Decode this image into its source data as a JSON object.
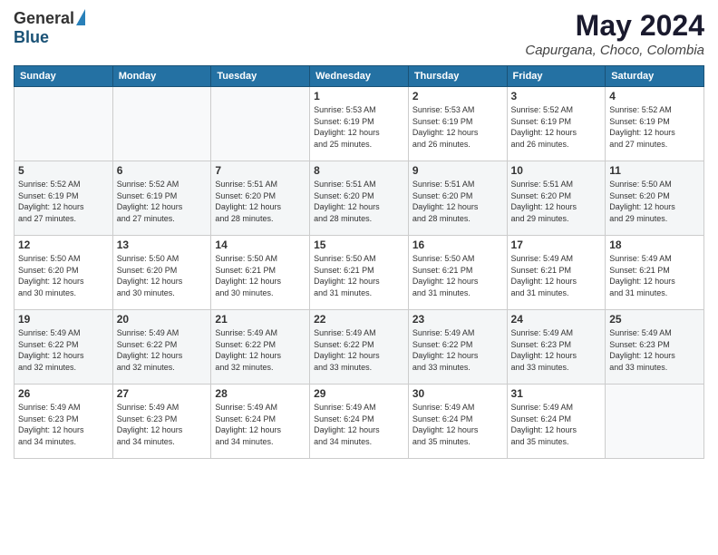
{
  "logo": {
    "general": "General",
    "blue": "Blue"
  },
  "title": {
    "month": "May 2024",
    "location": "Capurgana, Choco, Colombia"
  },
  "days_header": [
    "Sunday",
    "Monday",
    "Tuesday",
    "Wednesday",
    "Thursday",
    "Friday",
    "Saturday"
  ],
  "weeks": [
    [
      {
        "day": "",
        "info": ""
      },
      {
        "day": "",
        "info": ""
      },
      {
        "day": "",
        "info": ""
      },
      {
        "day": "1",
        "info": "Sunrise: 5:53 AM\nSunset: 6:19 PM\nDaylight: 12 hours\nand 25 minutes."
      },
      {
        "day": "2",
        "info": "Sunrise: 5:53 AM\nSunset: 6:19 PM\nDaylight: 12 hours\nand 26 minutes."
      },
      {
        "day": "3",
        "info": "Sunrise: 5:52 AM\nSunset: 6:19 PM\nDaylight: 12 hours\nand 26 minutes."
      },
      {
        "day": "4",
        "info": "Sunrise: 5:52 AM\nSunset: 6:19 PM\nDaylight: 12 hours\nand 27 minutes."
      }
    ],
    [
      {
        "day": "5",
        "info": "Sunrise: 5:52 AM\nSunset: 6:19 PM\nDaylight: 12 hours\nand 27 minutes."
      },
      {
        "day": "6",
        "info": "Sunrise: 5:52 AM\nSunset: 6:19 PM\nDaylight: 12 hours\nand 27 minutes."
      },
      {
        "day": "7",
        "info": "Sunrise: 5:51 AM\nSunset: 6:20 PM\nDaylight: 12 hours\nand 28 minutes."
      },
      {
        "day": "8",
        "info": "Sunrise: 5:51 AM\nSunset: 6:20 PM\nDaylight: 12 hours\nand 28 minutes."
      },
      {
        "day": "9",
        "info": "Sunrise: 5:51 AM\nSunset: 6:20 PM\nDaylight: 12 hours\nand 28 minutes."
      },
      {
        "day": "10",
        "info": "Sunrise: 5:51 AM\nSunset: 6:20 PM\nDaylight: 12 hours\nand 29 minutes."
      },
      {
        "day": "11",
        "info": "Sunrise: 5:50 AM\nSunset: 6:20 PM\nDaylight: 12 hours\nand 29 minutes."
      }
    ],
    [
      {
        "day": "12",
        "info": "Sunrise: 5:50 AM\nSunset: 6:20 PM\nDaylight: 12 hours\nand 30 minutes."
      },
      {
        "day": "13",
        "info": "Sunrise: 5:50 AM\nSunset: 6:20 PM\nDaylight: 12 hours\nand 30 minutes."
      },
      {
        "day": "14",
        "info": "Sunrise: 5:50 AM\nSunset: 6:21 PM\nDaylight: 12 hours\nand 30 minutes."
      },
      {
        "day": "15",
        "info": "Sunrise: 5:50 AM\nSunset: 6:21 PM\nDaylight: 12 hours\nand 31 minutes."
      },
      {
        "day": "16",
        "info": "Sunrise: 5:50 AM\nSunset: 6:21 PM\nDaylight: 12 hours\nand 31 minutes."
      },
      {
        "day": "17",
        "info": "Sunrise: 5:49 AM\nSunset: 6:21 PM\nDaylight: 12 hours\nand 31 minutes."
      },
      {
        "day": "18",
        "info": "Sunrise: 5:49 AM\nSunset: 6:21 PM\nDaylight: 12 hours\nand 31 minutes."
      }
    ],
    [
      {
        "day": "19",
        "info": "Sunrise: 5:49 AM\nSunset: 6:22 PM\nDaylight: 12 hours\nand 32 minutes."
      },
      {
        "day": "20",
        "info": "Sunrise: 5:49 AM\nSunset: 6:22 PM\nDaylight: 12 hours\nand 32 minutes."
      },
      {
        "day": "21",
        "info": "Sunrise: 5:49 AM\nSunset: 6:22 PM\nDaylight: 12 hours\nand 32 minutes."
      },
      {
        "day": "22",
        "info": "Sunrise: 5:49 AM\nSunset: 6:22 PM\nDaylight: 12 hours\nand 33 minutes."
      },
      {
        "day": "23",
        "info": "Sunrise: 5:49 AM\nSunset: 6:22 PM\nDaylight: 12 hours\nand 33 minutes."
      },
      {
        "day": "24",
        "info": "Sunrise: 5:49 AM\nSunset: 6:23 PM\nDaylight: 12 hours\nand 33 minutes."
      },
      {
        "day": "25",
        "info": "Sunrise: 5:49 AM\nSunset: 6:23 PM\nDaylight: 12 hours\nand 33 minutes."
      }
    ],
    [
      {
        "day": "26",
        "info": "Sunrise: 5:49 AM\nSunset: 6:23 PM\nDaylight: 12 hours\nand 34 minutes."
      },
      {
        "day": "27",
        "info": "Sunrise: 5:49 AM\nSunset: 6:23 PM\nDaylight: 12 hours\nand 34 minutes."
      },
      {
        "day": "28",
        "info": "Sunrise: 5:49 AM\nSunset: 6:24 PM\nDaylight: 12 hours\nand 34 minutes."
      },
      {
        "day": "29",
        "info": "Sunrise: 5:49 AM\nSunset: 6:24 PM\nDaylight: 12 hours\nand 34 minutes."
      },
      {
        "day": "30",
        "info": "Sunrise: 5:49 AM\nSunset: 6:24 PM\nDaylight: 12 hours\nand 35 minutes."
      },
      {
        "day": "31",
        "info": "Sunrise: 5:49 AM\nSunset: 6:24 PM\nDaylight: 12 hours\nand 35 minutes."
      },
      {
        "day": "",
        "info": ""
      }
    ]
  ]
}
